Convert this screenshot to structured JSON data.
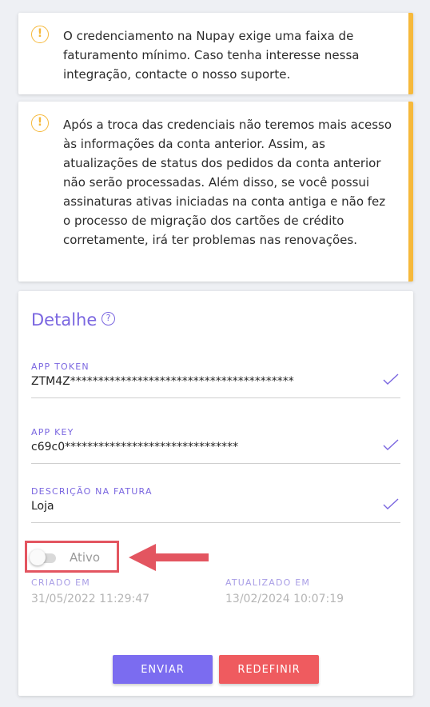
{
  "alerts": [
    {
      "text": "O credenciamento na Nupay exige uma faixa de faturamento mínimo. Caso tenha interesse nessa integração, contacte o nosso suporte."
    },
    {
      "text": "Após a troca das credenciais não teremos mais acesso às informações da conta anterior. Assim, as atualizações de status dos pedidos da conta anterior não serão processadas. Além disso, se você possui assinaturas ativas iniciadas na conta antiga e não fez o processo de migração dos cartões de crédito corretamente, irá ter problemas nas renovações."
    }
  ],
  "detail": {
    "title": "Detalhe",
    "fields": [
      {
        "label": "APP TOKEN",
        "value": "ZTM4Z****************************************"
      },
      {
        "label": "APP KEY",
        "value": "c69c0*******************************"
      },
      {
        "label": "DESCRIÇÃO NA FATURA",
        "value": "Loja"
      }
    ],
    "toggle": {
      "label": "Ativo",
      "checked": false
    },
    "created": {
      "label": "CRIADO EM",
      "value": "31/05/2022 11:29:47"
    },
    "updated": {
      "label": "ATUALIZADO EM",
      "value": "13/02/2024 10:07:19"
    },
    "buttons": {
      "send": "ENVIAR",
      "reset": "REDEFINIR"
    }
  },
  "colors": {
    "accent": "#7a66e0",
    "warning": "#f6b93b",
    "danger": "#ef5b5f",
    "highlight": "#e35560"
  }
}
